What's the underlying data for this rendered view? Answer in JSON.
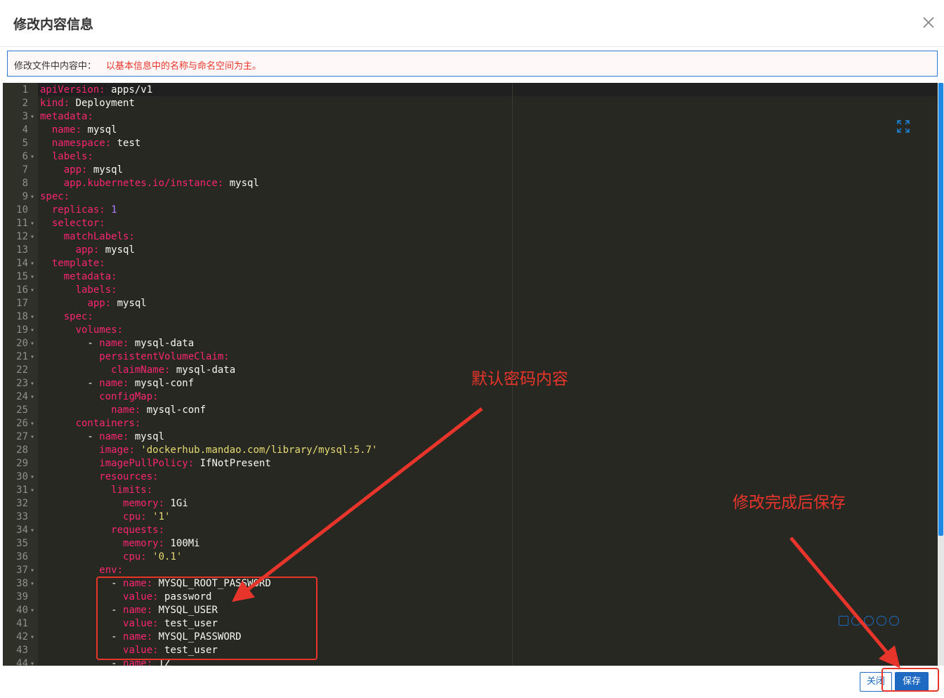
{
  "dialog": {
    "title": "修改内容信息",
    "close_icon": "close-icon"
  },
  "notice": {
    "label": "修改文件中内容中：",
    "text": "以基本信息中的名称与命名空间为主。"
  },
  "editor": {
    "lines": [
      {
        "n": "1",
        "fold": "",
        "indent": "",
        "key": "apiVersion:",
        "val": " apps/v1",
        "vt": "v"
      },
      {
        "n": "2",
        "fold": "",
        "indent": "",
        "key": "kind:",
        "val": " Deployment",
        "vt": "v"
      },
      {
        "n": "3",
        "fold": "▾",
        "indent": "",
        "key": "metadata:",
        "val": "",
        "vt": "v"
      },
      {
        "n": "4",
        "fold": "",
        "indent": "  ",
        "key": "name:",
        "val": " mysql",
        "vt": "v"
      },
      {
        "n": "5",
        "fold": "",
        "indent": "  ",
        "key": "namespace:",
        "val": " test",
        "vt": "v"
      },
      {
        "n": "6",
        "fold": "▾",
        "indent": "  ",
        "key": "labels:",
        "val": "",
        "vt": "v"
      },
      {
        "n": "7",
        "fold": "",
        "indent": "    ",
        "key": "app:",
        "val": " mysql",
        "vt": "v"
      },
      {
        "n": "8",
        "fold": "",
        "indent": "    ",
        "key": "app.kubernetes.io/instance:",
        "val": " mysql",
        "vt": "v"
      },
      {
        "n": "9",
        "fold": "▾",
        "indent": "",
        "key": "spec:",
        "val": "",
        "vt": "v"
      },
      {
        "n": "10",
        "fold": "",
        "indent": "  ",
        "key": "replicas:",
        "val": " 1",
        "vt": "n"
      },
      {
        "n": "11",
        "fold": "▾",
        "indent": "  ",
        "key": "selector:",
        "val": "",
        "vt": "v"
      },
      {
        "n": "12",
        "fold": "▾",
        "indent": "    ",
        "key": "matchLabels:",
        "val": "",
        "vt": "v"
      },
      {
        "n": "13",
        "fold": "",
        "indent": "      ",
        "key": "app:",
        "val": " mysql",
        "vt": "v"
      },
      {
        "n": "14",
        "fold": "▾",
        "indent": "  ",
        "key": "template:",
        "val": "",
        "vt": "v"
      },
      {
        "n": "15",
        "fold": "▾",
        "indent": "    ",
        "key": "metadata:",
        "val": "",
        "vt": "v"
      },
      {
        "n": "16",
        "fold": "▾",
        "indent": "      ",
        "key": "labels:",
        "val": "",
        "vt": "v"
      },
      {
        "n": "17",
        "fold": "",
        "indent": "        ",
        "key": "app:",
        "val": " mysql",
        "vt": "v"
      },
      {
        "n": "18",
        "fold": "▾",
        "indent": "    ",
        "key": "spec:",
        "val": "",
        "vt": "v"
      },
      {
        "n": "19",
        "fold": "▾",
        "indent": "      ",
        "key": "volumes:",
        "val": "",
        "vt": "v"
      },
      {
        "n": "20",
        "fold": "▾",
        "indent": "        - ",
        "key": "name:",
        "val": " mysql-data",
        "vt": "v"
      },
      {
        "n": "21",
        "fold": "▾",
        "indent": "          ",
        "key": "persistentVolumeClaim:",
        "val": "",
        "vt": "v"
      },
      {
        "n": "22",
        "fold": "",
        "indent": "            ",
        "key": "claimName:",
        "val": " mysql-data",
        "vt": "v"
      },
      {
        "n": "23",
        "fold": "▾",
        "indent": "        - ",
        "key": "name:",
        "val": " mysql-conf",
        "vt": "v"
      },
      {
        "n": "24",
        "fold": "▾",
        "indent": "          ",
        "key": "configMap:",
        "val": "",
        "vt": "v"
      },
      {
        "n": "25",
        "fold": "",
        "indent": "            ",
        "key": "name:",
        "val": " mysql-conf",
        "vt": "v"
      },
      {
        "n": "26",
        "fold": "▾",
        "indent": "      ",
        "key": "containers:",
        "val": "",
        "vt": "v"
      },
      {
        "n": "27",
        "fold": "▾",
        "indent": "        - ",
        "key": "name:",
        "val": " mysql",
        "vt": "v"
      },
      {
        "n": "28",
        "fold": "",
        "indent": "          ",
        "key": "image:",
        "val": " 'dockerhub.mandao.com/library/mysql:5.7'",
        "vt": "s"
      },
      {
        "n": "29",
        "fold": "",
        "indent": "          ",
        "key": "imagePullPolicy:",
        "val": " IfNotPresent",
        "vt": "v"
      },
      {
        "n": "30",
        "fold": "▾",
        "indent": "          ",
        "key": "resources:",
        "val": "",
        "vt": "v"
      },
      {
        "n": "31",
        "fold": "▾",
        "indent": "            ",
        "key": "limits:",
        "val": "",
        "vt": "v"
      },
      {
        "n": "32",
        "fold": "",
        "indent": "              ",
        "key": "memory:",
        "val": " 1Gi",
        "vt": "v"
      },
      {
        "n": "33",
        "fold": "",
        "indent": "              ",
        "key": "cpu:",
        "val": " '1'",
        "vt": "s"
      },
      {
        "n": "34",
        "fold": "▾",
        "indent": "            ",
        "key": "requests:",
        "val": "",
        "vt": "v"
      },
      {
        "n": "35",
        "fold": "",
        "indent": "              ",
        "key": "memory:",
        "val": " 100Mi",
        "vt": "v"
      },
      {
        "n": "36",
        "fold": "",
        "indent": "              ",
        "key": "cpu:",
        "val": " '0.1'",
        "vt": "s"
      },
      {
        "n": "37",
        "fold": "▾",
        "indent": "          ",
        "key": "env:",
        "val": "",
        "vt": "v"
      },
      {
        "n": "38",
        "fold": "▾",
        "indent": "            - ",
        "key": "name:",
        "val": " MYSQL_ROOT_PASSWORD",
        "vt": "v"
      },
      {
        "n": "39",
        "fold": "",
        "indent": "              ",
        "key": "value:",
        "val": " password",
        "vt": "v"
      },
      {
        "n": "40",
        "fold": "▾",
        "indent": "            - ",
        "key": "name:",
        "val": " MYSQL_USER",
        "vt": "v"
      },
      {
        "n": "41",
        "fold": "",
        "indent": "              ",
        "key": "value:",
        "val": " test_user",
        "vt": "v"
      },
      {
        "n": "42",
        "fold": "▾",
        "indent": "            - ",
        "key": "name:",
        "val": " MYSQL_PASSWORD",
        "vt": "v"
      },
      {
        "n": "43",
        "fold": "",
        "indent": "              ",
        "key": "value:",
        "val": " test_user",
        "vt": "v"
      },
      {
        "n": "44",
        "fold": "▾",
        "indent": "            - ",
        "key": "name:",
        "val": " TZ",
        "vt": "v"
      }
    ],
    "expand_icon": "expand-icon",
    "toolbar_icons": [
      "file-icon",
      "circle-icon",
      "comment-icon",
      "upload-icon",
      "download-icon"
    ],
    "colors": {
      "background": "#272822",
      "key": "#f92672",
      "value": "#f8f8f2",
      "string": "#e6db74",
      "number": "#ae81ff"
    }
  },
  "annotations": {
    "default_password": "默认密码内容",
    "save_after_edit": "修改完成后保存",
    "color": "#e7352b"
  },
  "footer": {
    "close_label": "关闭",
    "save_label": "保存",
    "accent": "#1e6ac2"
  }
}
